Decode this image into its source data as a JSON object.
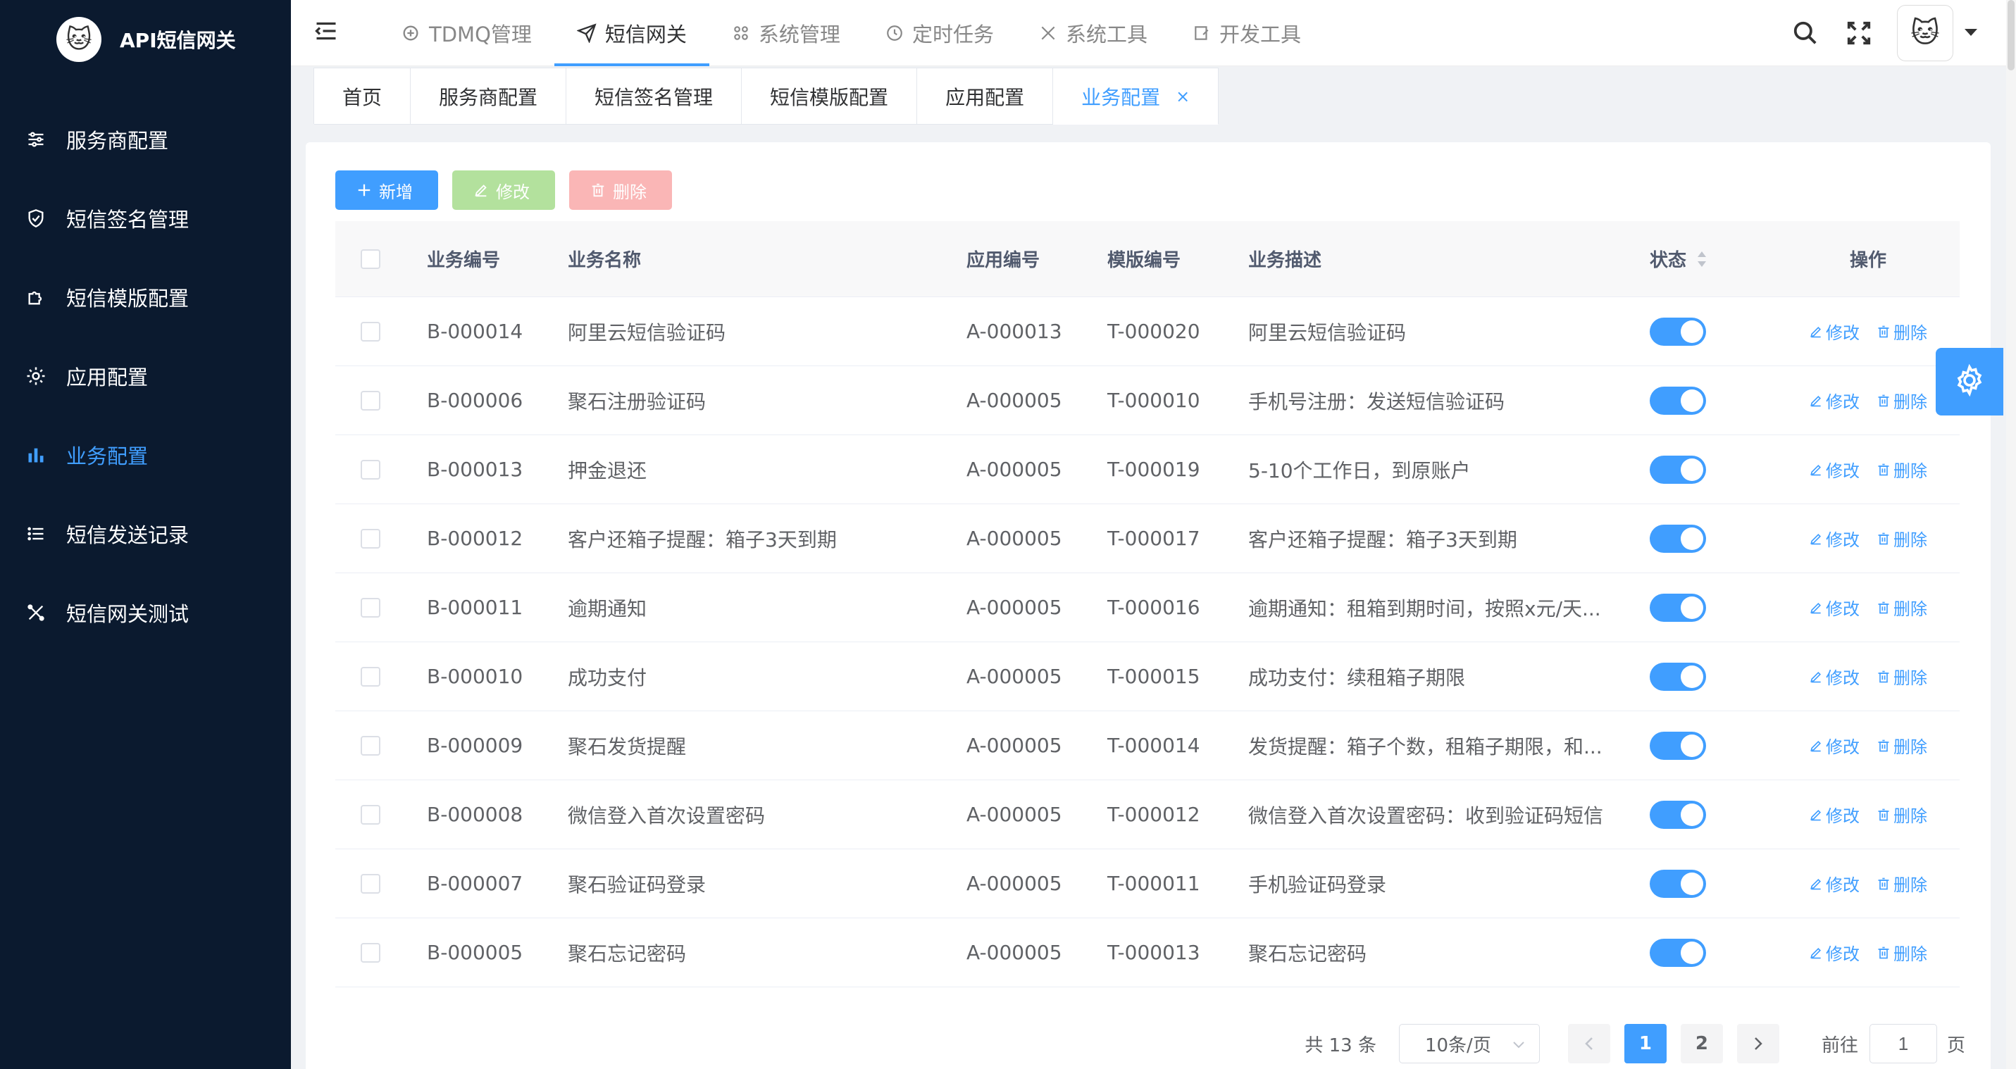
{
  "brand": {
    "title": "API短信网关"
  },
  "sidebar": {
    "items": [
      {
        "label": "服务商配置",
        "icon": "sliders-icon",
        "active": false
      },
      {
        "label": "短信签名管理",
        "icon": "shield-icon",
        "active": false
      },
      {
        "label": "短信模版配置",
        "icon": "puzzle-icon",
        "active": false
      },
      {
        "label": "应用配置",
        "icon": "gear-icon",
        "active": false
      },
      {
        "label": "业务配置",
        "icon": "bar-chart-icon",
        "active": true
      },
      {
        "label": "短信发送记录",
        "icon": "list-icon",
        "active": false
      },
      {
        "label": "短信网关测试",
        "icon": "tools-icon",
        "active": false
      }
    ]
  },
  "topnav": {
    "items": [
      {
        "label": "TDMQ管理",
        "active": false
      },
      {
        "label": "短信网关",
        "active": true
      },
      {
        "label": "系统管理",
        "active": false
      },
      {
        "label": "定时任务",
        "active": false
      },
      {
        "label": "系统工具",
        "active": false
      },
      {
        "label": "开发工具",
        "active": false
      }
    ]
  },
  "tabs": [
    {
      "label": "首页",
      "active": false
    },
    {
      "label": "服务商配置",
      "active": false
    },
    {
      "label": "短信签名管理",
      "active": false
    },
    {
      "label": "短信模版配置",
      "active": false
    },
    {
      "label": "应用配置",
      "active": false
    },
    {
      "label": "业务配置",
      "active": true,
      "closable": "×"
    }
  ],
  "toolbar": {
    "add_label": "新增",
    "edit_label": "修改",
    "delete_label": "删除"
  },
  "table": {
    "headers": {
      "code": "业务编号",
      "name": "业务名称",
      "app": "应用编号",
      "tpl": "模版编号",
      "desc": "业务描述",
      "status": "状态",
      "ops": "操作"
    },
    "op_edit": "修改",
    "op_delete": "删除",
    "rows": [
      {
        "code": "B-000014",
        "name": "阿里云短信验证码",
        "app": "A-000013",
        "tpl": "T-000020",
        "desc": "阿里云短信验证码",
        "status": true
      },
      {
        "code": "B-000006",
        "name": "聚石注册验证码",
        "app": "A-000005",
        "tpl": "T-000010",
        "desc": "手机号注册：发送短信验证码",
        "status": true
      },
      {
        "code": "B-000013",
        "name": "押金退还",
        "app": "A-000005",
        "tpl": "T-000019",
        "desc": "5-10个工作日，到原账户",
        "status": true
      },
      {
        "code": "B-000012",
        "name": "客户还箱子提醒：箱子3天到期",
        "app": "A-000005",
        "tpl": "T-000017",
        "desc": "客户还箱子提醒：箱子3天到期",
        "status": true
      },
      {
        "code": "B-000011",
        "name": "逾期通知",
        "app": "A-000005",
        "tpl": "T-000016",
        "desc": "逾期通知：租箱到期时间，按照x元/天...",
        "status": true
      },
      {
        "code": "B-000010",
        "name": "成功支付",
        "app": "A-000005",
        "tpl": "T-000015",
        "desc": "成功支付：续租箱子期限",
        "status": true
      },
      {
        "code": "B-000009",
        "name": "聚石发货提醒",
        "app": "A-000005",
        "tpl": "T-000014",
        "desc": "发货提醒：箱子个数，租箱子期限，和...",
        "status": true
      },
      {
        "code": "B-000008",
        "name": "微信登入首次设置密码",
        "app": "A-000005",
        "tpl": "T-000012",
        "desc": "微信登入首次设置密码：收到验证码短信",
        "status": true
      },
      {
        "code": "B-000007",
        "name": "聚石验证码登录",
        "app": "A-000005",
        "tpl": "T-000011",
        "desc": "手机验证码登录",
        "status": true
      },
      {
        "code": "B-000005",
        "name": "聚石忘记密码",
        "app": "A-000005",
        "tpl": "T-000013",
        "desc": "聚石忘记密码",
        "status": true
      }
    ]
  },
  "pagination": {
    "total": "共 13 条",
    "page_size": "10条/页",
    "pages": [
      "1",
      "2"
    ],
    "current": "1",
    "goto_label": "前往",
    "goto_value": "1",
    "goto_suffix": "页"
  },
  "colors": {
    "primary": "#409eff",
    "sidebar_bg": "#0b1a2f"
  }
}
